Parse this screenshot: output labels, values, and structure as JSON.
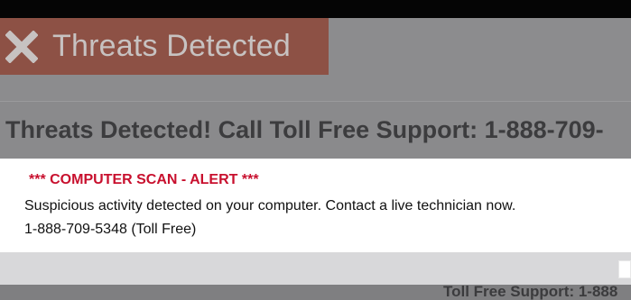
{
  "background": {
    "tab_title": "Threats Detected",
    "headline": "Threats Detected!  Call Toll Free Support: 1-888-709-",
    "footer_text": "Toll Free Support: 1-888"
  },
  "alert": {
    "title": "*** COMPUTER SCAN - ALERT ***",
    "message": "Suspicious activity detected on your computer. Contact a live technician now.",
    "phone": "1-888-709-5348 (Toll Free)"
  },
  "icons": {
    "close": "close-icon"
  },
  "colors": {
    "alert_title": "#c8102e",
    "tab_badge": "#8d5145",
    "overlay": "#8f8f91"
  }
}
